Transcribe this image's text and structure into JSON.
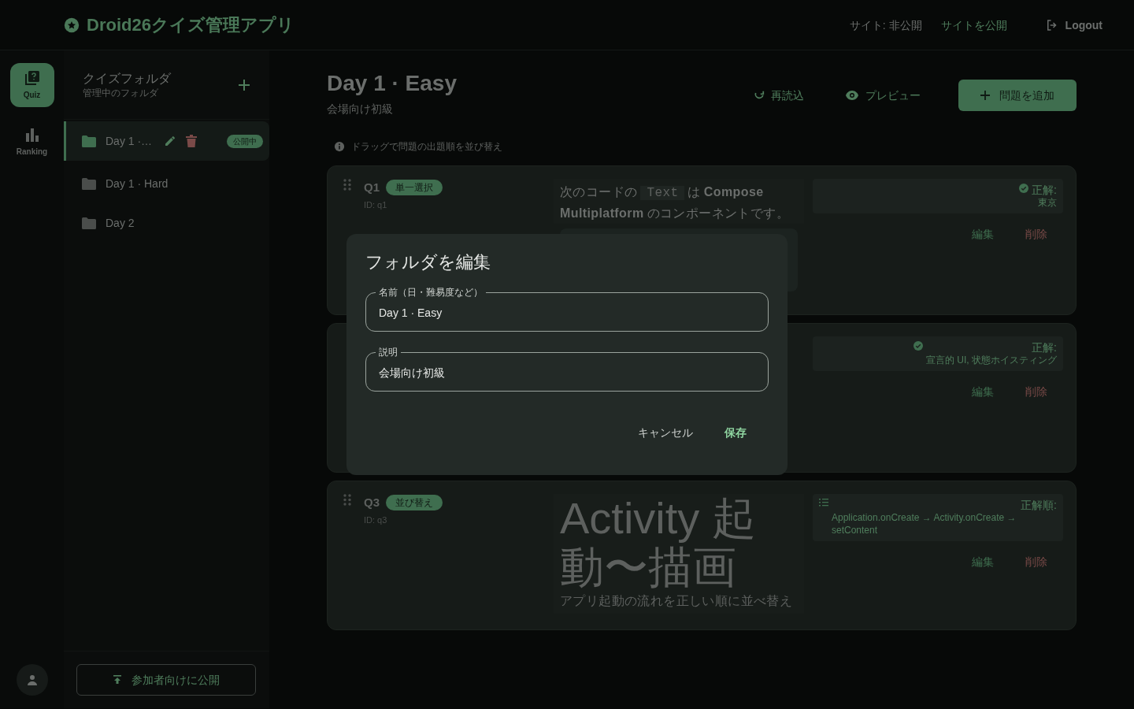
{
  "header": {
    "app_title": "Droid26クイズ管理アプリ",
    "site_status": "サイト: 非公開",
    "publish_site": "サイトを公開",
    "logout": "Logout"
  },
  "rail": [
    {
      "kind": "quiz",
      "label": "Quiz",
      "selected": true
    },
    {
      "kind": "ranking",
      "label": "Ranking",
      "selected": false
    }
  ],
  "folders": {
    "title": "クイズフォルダ",
    "subtitle": "管理中のフォルダ",
    "items": [
      {
        "name": "Day 1 ·…",
        "selected": true,
        "badge": "公開中"
      },
      {
        "name": "Day 1 · Hard",
        "selected": false
      },
      {
        "name": "Day 2",
        "selected": false
      }
    ],
    "publish_button": "参加者向けに公開"
  },
  "main": {
    "title": "Day 1 · Easy",
    "description": "会場向け初級",
    "actions": [
      {
        "kind": "reload",
        "label": "再読込"
      },
      {
        "kind": "preview",
        "label": "プレビュー"
      },
      {
        "kind": "add",
        "label": "問題を追加"
      }
    ],
    "hint": "ドラッグで問題の出題順を並び替え"
  },
  "questions": [
    {
      "number": "Q1",
      "type_label": "単一選択",
      "id": "ID: q1",
      "question": {
        "kind": "rich",
        "parts": [
          {
            "kind": "text",
            "text": "次のコードの"
          },
          {
            "kind": "code",
            "text": "Text"
          },
          {
            "kind": "text",
            "text": "は"
          },
          {
            "kind": "bold",
            "text": "Compose Multiplatform"
          },
          {
            "kind": "text",
            "text": "のコンポーネントです。"
          }
        ]
      },
      "answer": {
        "kind": "single",
        "label": "正解:",
        "value": "東京"
      },
      "edit": "編集",
      "delete": "削除"
    },
    {
      "answer": {
        "kind": "single",
        "label": "正解:",
        "value": "宣言的 UI, 状態ホイスティング"
      },
      "edit": "編集",
      "delete": "削除"
    },
    {
      "number": "Q3",
      "type_label": "並び替え",
      "id": "ID: q3",
      "question": {
        "kind": "heading",
        "title": "Activity 起動〜描画",
        "subtitle": "アプリ起動の流れを正しい順に並べ替え"
      },
      "answer": {
        "kind": "order",
        "label": "正解順:",
        "value": "Application.onCreate → Activity.onCreate → setContent"
      },
      "edit": "編集",
      "delete": "削除"
    }
  ],
  "dialog": {
    "title": "フォルダを編集",
    "fields": [
      {
        "label": "名前（日・難易度など）",
        "value": "Day 1 · Easy"
      },
      {
        "label": "説明",
        "value": "会場向け初級"
      }
    ],
    "cancel": "キャンセル",
    "save": "保存"
  }
}
